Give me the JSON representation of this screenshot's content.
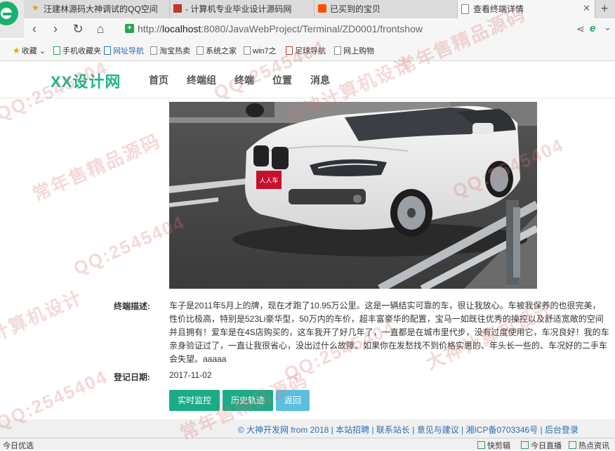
{
  "browser": {
    "tabs": [
      {
        "label": "汪建林源码大神调试的QQ空间"
      },
      {
        "label": "- 计算机专业毕业设计源码网"
      },
      {
        "label": "已买到的宝贝"
      },
      {
        "label": "查看终端详情"
      }
    ],
    "new_tab": "+",
    "url_prefix": "http://",
    "url_host": "localhost",
    "url_rest": ":8080/JavaWebProject/Terminal/ZD0001/frontshow",
    "bookmarks": [
      {
        "label": "收藏"
      },
      {
        "label": "手机收藏夹"
      },
      {
        "label": "网址导航"
      },
      {
        "label": "淘宝热卖"
      },
      {
        "label": "系统之家"
      },
      {
        "label": "win7之"
      },
      {
        "label": "足球导航"
      },
      {
        "label": "网上购物"
      }
    ]
  },
  "site": {
    "logo": "XX设计网",
    "nav": [
      {
        "label": "首页"
      },
      {
        "label": "终端组"
      },
      {
        "label": "终端"
      },
      {
        "label": "位置"
      },
      {
        "label": "消息"
      }
    ]
  },
  "detail": {
    "desc_label": "终端描述:",
    "desc_lines": [
      "车子是2011年5月上的牌，现在才跑了10.95万公里。这是一辆结实可靠的车，很让我放心。车被我保养的也很完美，",
      "性价比极高，特别是523Li豪华型，50万内的车价，超丰富豪华的配置，宝马一如既往优秀的操控以及舒适宽敞的空间",
      "并且拥有！爱车是在4S店购买的，这车我开了好几年了，一直都是在城市里代步，没有过度使用它，车况良好！我的车",
      "亲身验证过了，一直让我很省心，没出过什么故障。如果你在发愁找不到价格实惠的、年头长一些的、车况好的二手车",
      "会失望。aaaaa"
    ],
    "date_label": "登记日期:",
    "date_value": "2017-11-02",
    "plate": "人人车",
    "buttons": {
      "monitor": "实时监控",
      "history": "历史轨迹",
      "back": "返回"
    }
  },
  "footer": {
    "text": "© 大神开发网 from 2018 | 本站招聘 | 联系站长 | 意见与建议 | 湘ICP备0703346号 | 后台登录"
  },
  "statusbar": {
    "left": "今日优选",
    "items": [
      {
        "label": "快剪辑"
      },
      {
        "label": "今日直播"
      },
      {
        "label": "热点资讯"
      }
    ]
  },
  "watermarks": {
    "qq": "QQ:2545404",
    "slogan": "常年售精品源码",
    "design": "计算机设计",
    "god": "大神计算机设计"
  },
  "colors": {
    "accent": "#1cab87",
    "back_button": "#5bc0de",
    "footer_link": "#2d6fb0"
  }
}
